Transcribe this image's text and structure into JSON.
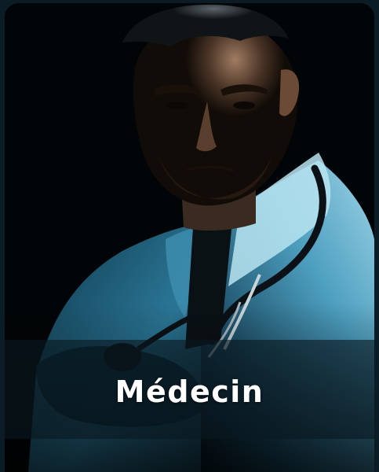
{
  "card": {
    "title": "Médecin",
    "image_alt": "doctor-portrait",
    "colors": {
      "page_background": "#0c1c27",
      "card_background": "#020507",
      "coat_blue": "#4fa6c6",
      "skin_tone": "#8a6a55",
      "caption_band": "#091820",
      "caption_text": "#ffffff"
    }
  }
}
